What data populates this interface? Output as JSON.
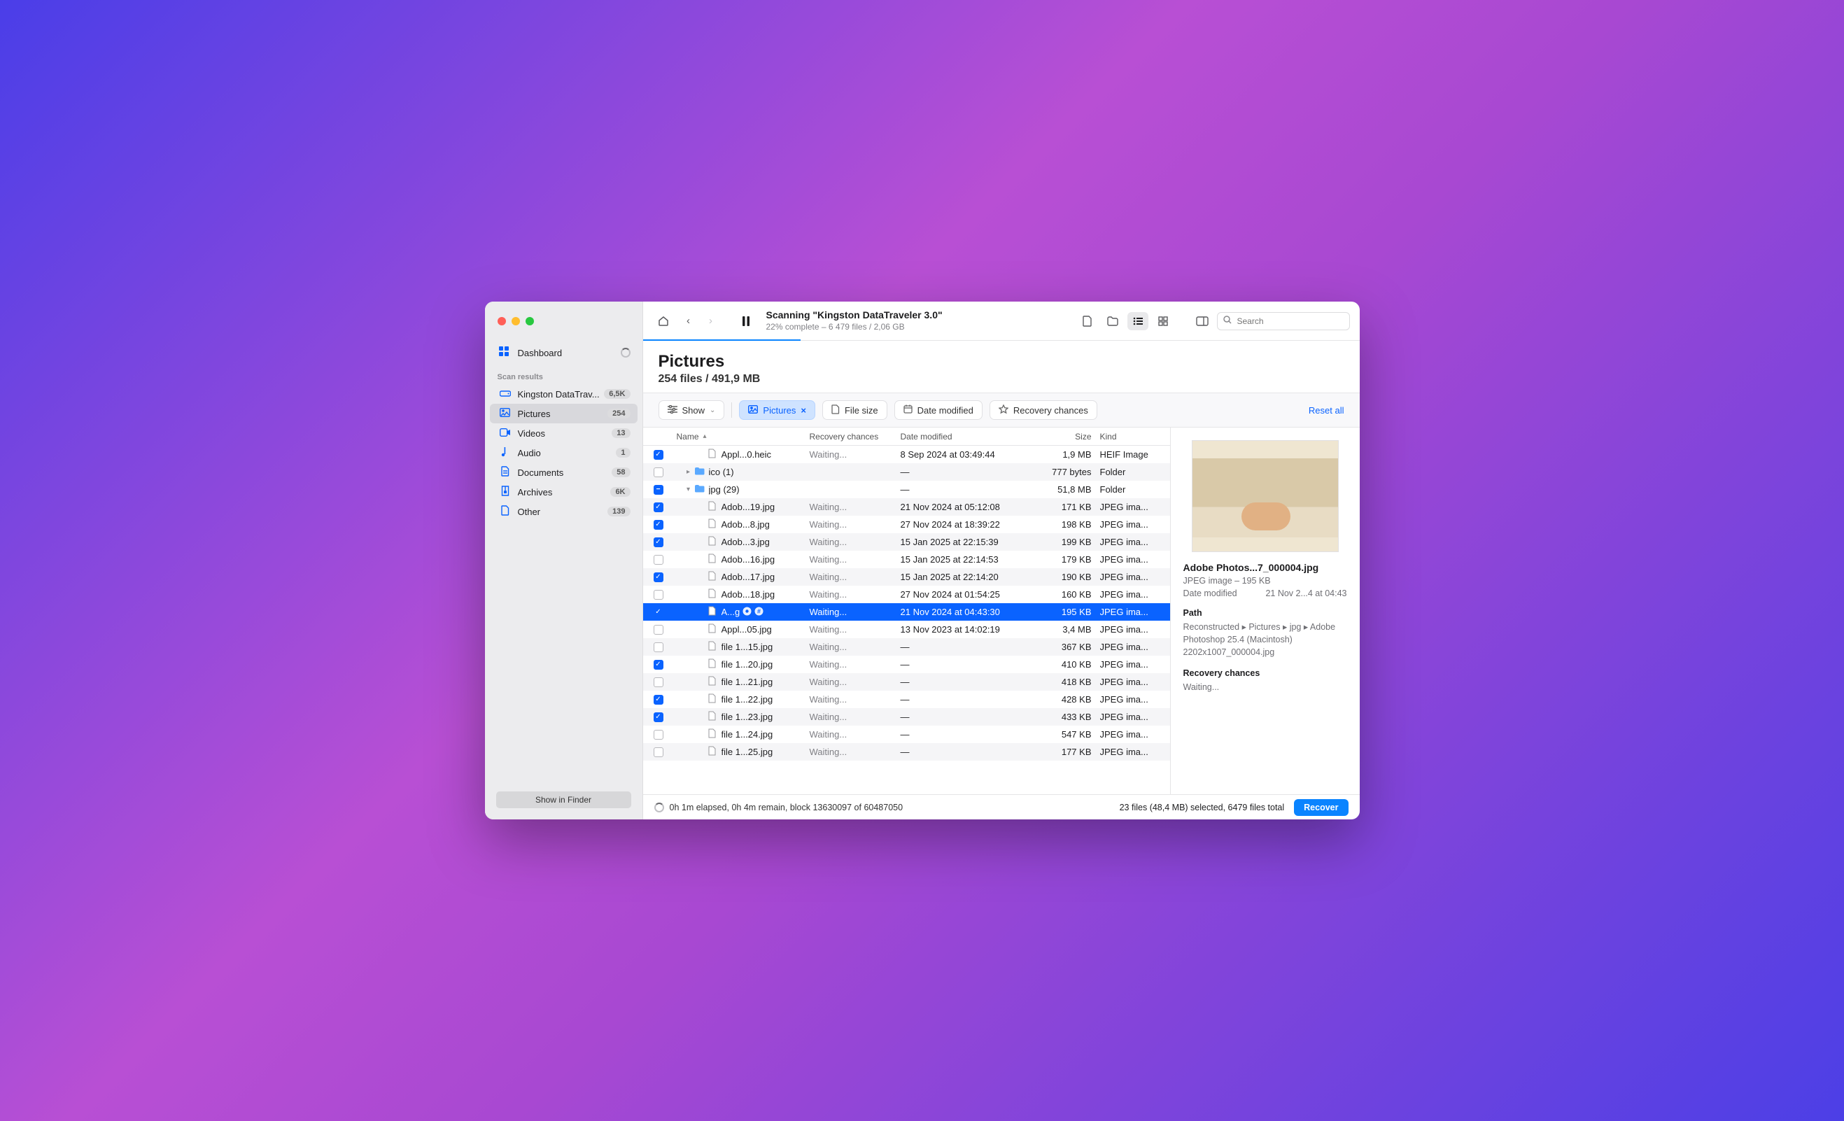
{
  "header": {
    "title": "Scanning \"Kingston DataTraveler 3.0\"",
    "subtitle": "22% complete – 6 479 files / 2,06 GB",
    "progress_percent": 22,
    "search_placeholder": "Search"
  },
  "sidebar": {
    "dashboard_label": "Dashboard",
    "section_label": "Scan results",
    "device": {
      "label": "Kingston DataTrav...",
      "badge": "6,5K"
    },
    "categories": [
      {
        "icon": "image",
        "label": "Pictures",
        "badge": "254",
        "selected": true
      },
      {
        "icon": "video",
        "label": "Videos",
        "badge": "13"
      },
      {
        "icon": "audio",
        "label": "Audio",
        "badge": "1"
      },
      {
        "icon": "doc",
        "label": "Documents",
        "badge": "58"
      },
      {
        "icon": "archive",
        "label": "Archives",
        "badge": "6K"
      },
      {
        "icon": "other",
        "label": "Other",
        "badge": "139"
      }
    ],
    "show_in_finder": "Show in Finder"
  },
  "section": {
    "title": "Pictures",
    "summary": "254 files / 491,9 MB"
  },
  "filters": {
    "show_label": "Show",
    "kind_label": "Pictures",
    "size_label": "File size",
    "date_label": "Date modified",
    "recov_label": "Recovery chances",
    "reset_label": "Reset all"
  },
  "columns": {
    "name": "Name",
    "recov": "Recovery chances",
    "date": "Date modified",
    "size": "Size",
    "kind": "Kind"
  },
  "rows": [
    {
      "check": "on",
      "depth": 2,
      "type": "file",
      "name": "Appl...0.heic",
      "rec": "Waiting...",
      "date": "8 Sep 2024 at 03:49:44",
      "size": "1,9 MB",
      "kind": "HEIF Image"
    },
    {
      "check": "off",
      "depth": 1,
      "type": "folder",
      "disc": "right",
      "name": "ico (1)",
      "rec": "",
      "date": "—",
      "size": "777 bytes",
      "kind": "Folder"
    },
    {
      "check": "mixed",
      "depth": 1,
      "type": "folder",
      "disc": "down",
      "name": "jpg (29)",
      "rec": "",
      "date": "—",
      "size": "51,8 MB",
      "kind": "Folder"
    },
    {
      "check": "on",
      "depth": 2,
      "type": "file",
      "name": "Adob...19.jpg",
      "rec": "Waiting...",
      "date": "21 Nov 2024 at 05:12:08",
      "size": "171 KB",
      "kind": "JPEG ima..."
    },
    {
      "check": "on",
      "depth": 2,
      "type": "file",
      "name": "Adob...8.jpg",
      "rec": "Waiting...",
      "date": "27 Nov 2024 at 18:39:22",
      "size": "198 KB",
      "kind": "JPEG ima..."
    },
    {
      "check": "on",
      "depth": 2,
      "type": "file",
      "name": "Adob...3.jpg",
      "rec": "Waiting...",
      "date": "15 Jan 2025 at 22:15:39",
      "size": "199 KB",
      "kind": "JPEG ima..."
    },
    {
      "check": "off",
      "depth": 2,
      "type": "file",
      "name": "Adob...16.jpg",
      "rec": "Waiting...",
      "date": "15 Jan 2025 at 22:14:53",
      "size": "179 KB",
      "kind": "JPEG ima..."
    },
    {
      "check": "on",
      "depth": 2,
      "type": "file",
      "name": "Adob...17.jpg",
      "rec": "Waiting...",
      "date": "15 Jan 2025 at 22:14:20",
      "size": "190 KB",
      "kind": "JPEG ima..."
    },
    {
      "check": "off",
      "depth": 2,
      "type": "file",
      "name": "Adob...18.jpg",
      "rec": "Waiting...",
      "date": "27 Nov 2024 at 01:54:25",
      "size": "160 KB",
      "kind": "JPEG ima..."
    },
    {
      "check": "on",
      "depth": 2,
      "type": "file",
      "name": "A...g",
      "rec": "Waiting...",
      "date": "21 Nov 2024 at 04:43:30",
      "size": "195 KB",
      "kind": "JPEG ima...",
      "selected": true,
      "tags": true
    },
    {
      "check": "off",
      "depth": 2,
      "type": "file",
      "name": "Appl...05.jpg",
      "rec": "Waiting...",
      "date": "13 Nov 2023 at 14:02:19",
      "size": "3,4 MB",
      "kind": "JPEG ima..."
    },
    {
      "check": "off",
      "depth": 2,
      "type": "file",
      "name": "file 1...15.jpg",
      "rec": "Waiting...",
      "date": "—",
      "size": "367 KB",
      "kind": "JPEG ima..."
    },
    {
      "check": "on",
      "depth": 2,
      "type": "file",
      "name": "file 1...20.jpg",
      "rec": "Waiting...",
      "date": "—",
      "size": "410 KB",
      "kind": "JPEG ima..."
    },
    {
      "check": "off",
      "depth": 2,
      "type": "file",
      "name": "file 1...21.jpg",
      "rec": "Waiting...",
      "date": "—",
      "size": "418 KB",
      "kind": "JPEG ima..."
    },
    {
      "check": "on",
      "depth": 2,
      "type": "file",
      "name": "file 1...22.jpg",
      "rec": "Waiting...",
      "date": "—",
      "size": "428 KB",
      "kind": "JPEG ima..."
    },
    {
      "check": "on",
      "depth": 2,
      "type": "file",
      "name": "file 1...23.jpg",
      "rec": "Waiting...",
      "date": "—",
      "size": "433 KB",
      "kind": "JPEG ima..."
    },
    {
      "check": "off",
      "depth": 2,
      "type": "file",
      "name": "file 1...24.jpg",
      "rec": "Waiting...",
      "date": "—",
      "size": "547 KB",
      "kind": "JPEG ima..."
    },
    {
      "check": "off",
      "depth": 2,
      "type": "file",
      "name": "file 1...25.jpg",
      "rec": "Waiting...",
      "date": "—",
      "size": "177 KB",
      "kind": "JPEG ima..."
    }
  ],
  "preview": {
    "title": "Adobe Photos...7_000004.jpg",
    "meta": "JPEG image – 195 KB",
    "date_label": "Date modified",
    "date_value": "21 Nov 2...4 at 04:43",
    "path_label": "Path",
    "path_value": "Reconstructed ▸ Pictures ▸ jpg ▸ Adobe Photoshop 25.4 (Macintosh) 2202x1007_000004.jpg",
    "recov_label": "Recovery chances",
    "recov_value": "Waiting..."
  },
  "footer": {
    "status": "0h 1m elapsed, 0h 4m remain, block 13630097 of 60487050",
    "selection": "23 files (48,4 MB) selected, 6479 files total",
    "recover_label": "Recover"
  }
}
